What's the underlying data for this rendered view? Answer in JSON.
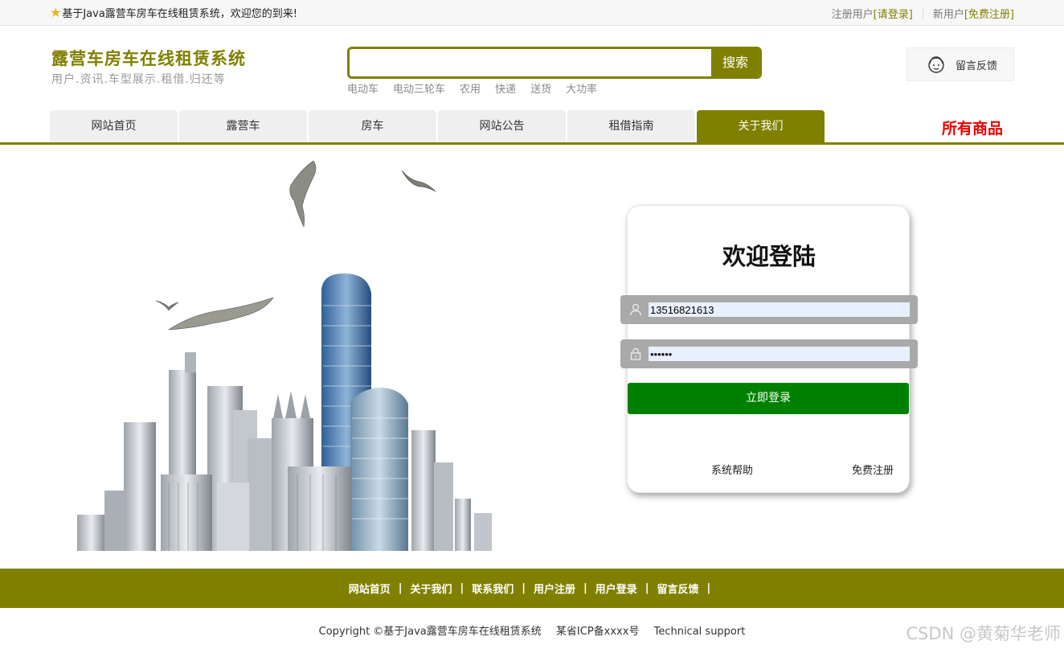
{
  "topbar": {
    "welcome": "基于Java露营车房车在线租赁系统，欢迎您的到来!",
    "register_user_label": "注册用户",
    "login_link": "[请登录]",
    "new_user_label": "新用户",
    "free_register_link": "[免费注册]"
  },
  "header": {
    "title": "露营车房车在线租赁系统",
    "subtitle": "用户.资讯.车型展示.租借.归还等",
    "search": {
      "value": "",
      "placeholder": "",
      "button": "搜索"
    },
    "hot_keywords": [
      "电动车",
      "电动三轮车",
      "农用",
      "快递",
      "送货",
      "大功率"
    ],
    "feedback_label": "留言反馈"
  },
  "nav": {
    "tabs": [
      "网站首页",
      "露营车",
      "房车",
      "网站公告",
      "租借指南",
      "关于我们"
    ],
    "active_index": 5,
    "all_products": "所有商品"
  },
  "login": {
    "title": "欢迎登陆",
    "username_value": "13516821613",
    "password_value": "••••••",
    "submit": "立即登录",
    "help_link": "系统帮助",
    "register_link": "免费注册"
  },
  "footer": {
    "links": [
      "网站首页",
      "关于我们",
      "联系我们",
      "用户注册",
      "用户登录",
      "留言反馈"
    ],
    "copyright": "Copyright ©基于Java露营车房车在线租赁系统",
    "icp": "某省ICP备xxxx号",
    "support": "Technical support",
    "watermark": "CSDN @黄菊华老师"
  },
  "colors": {
    "brand": "#808000",
    "login_button": "#008000",
    "all_products": "#ee0000"
  }
}
